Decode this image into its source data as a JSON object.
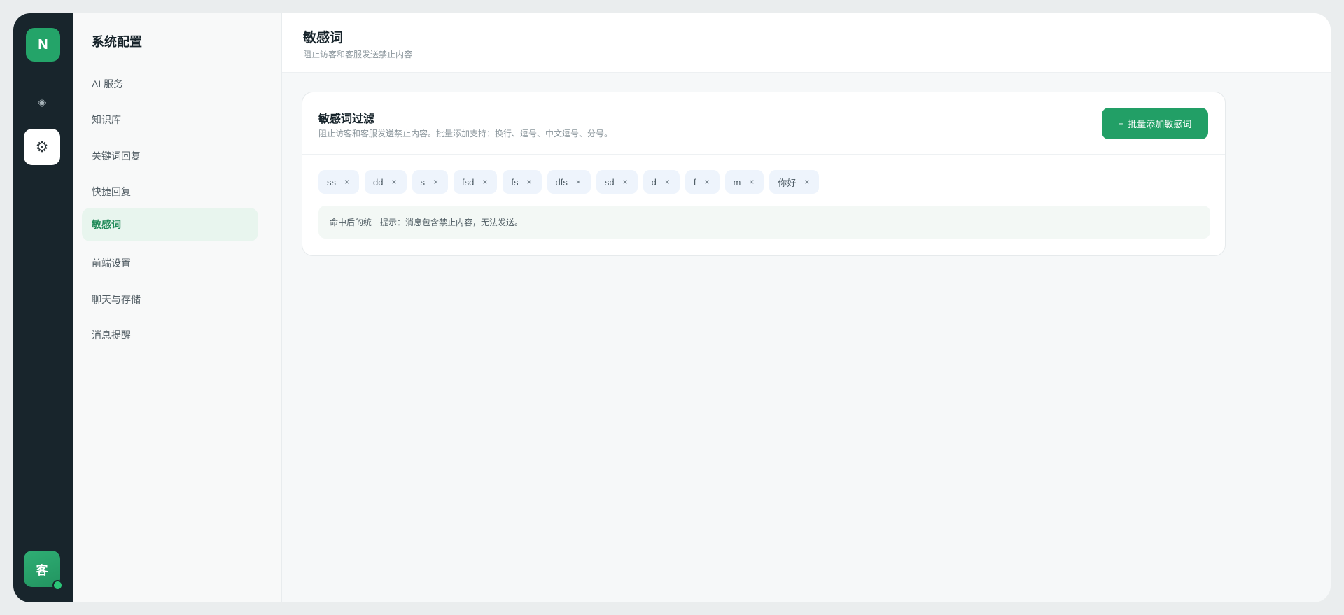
{
  "rail": {
    "logo": "N",
    "avatar": "客",
    "icons": [
      "diamond-icon",
      "gear-icon"
    ]
  },
  "sidebar": {
    "title": "系统配置",
    "items": [
      {
        "label": "AI 服务"
      },
      {
        "label": "知识库"
      },
      {
        "label": "关键词回复"
      },
      {
        "label": "快捷回复"
      },
      {
        "label": "敏感词",
        "active": true
      },
      {
        "label": "前端设置"
      },
      {
        "label": "聊天与存储"
      },
      {
        "label": "消息提醒"
      }
    ]
  },
  "header": {
    "title": "敏感词",
    "subtitle": "阻止访客和客服发送禁止内容"
  },
  "card": {
    "title": "敏感词过滤",
    "description": "阻止访客和客服发送禁止内容。批量添加支持：换行、逗号、中文逗号、分号。",
    "add_button": "批量添加敏感词",
    "add_icon": "+",
    "tags": [
      "ss",
      "dd",
      "s",
      "fsd",
      "fs",
      "dfs",
      "sd",
      "d",
      "f",
      "m",
      "你好"
    ],
    "remove_glyph": "×",
    "hint": "命中后的统一提示：消息包含禁止内容，无法发送。"
  },
  "colors": {
    "accent": "#229f66",
    "rail_bg": "#18252c",
    "active_nav_bg": "#e8f5ee",
    "tag_bg": "#eef4fc"
  }
}
